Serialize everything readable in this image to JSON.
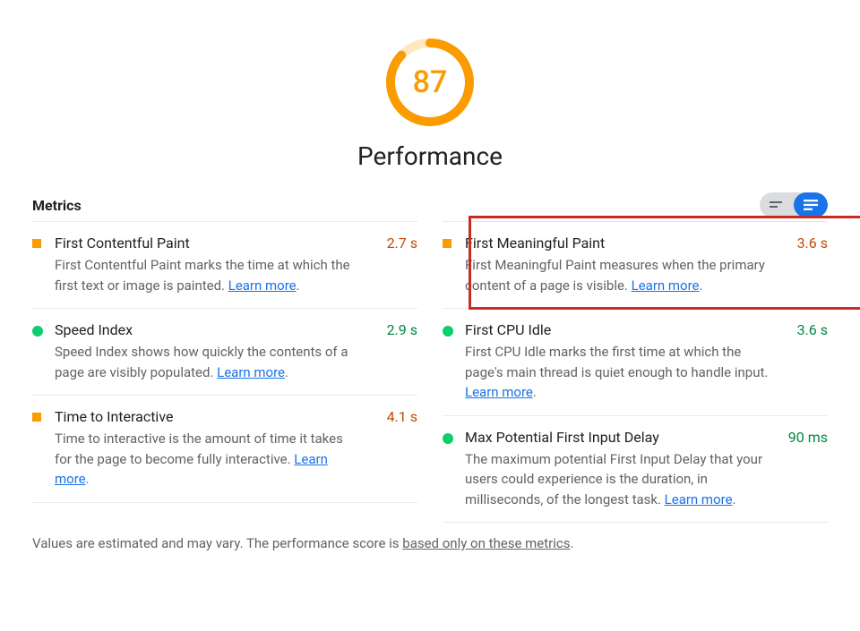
{
  "header": {
    "score": "87",
    "title": "Performance",
    "gauge_color": "#fa9b00",
    "gauge_fraction": 0.87
  },
  "section": {
    "title": "Metrics"
  },
  "learn_more_label": "Learn more",
  "left_metrics": [
    {
      "status": "warn",
      "title": "First Contentful Paint",
      "desc_before": "First Contentful Paint marks the time at which the first text or image is painted. ",
      "desc_after": ".",
      "value": "2.7 s",
      "value_class": "val-warn"
    },
    {
      "status": "pass",
      "title": "Speed Index",
      "desc_before": "Speed Index shows how quickly the contents of a page are visibly populated. ",
      "desc_after": ".",
      "value": "2.9 s",
      "value_class": "val-pass"
    },
    {
      "status": "warn",
      "title": "Time to Interactive",
      "desc_before": "Time to interactive is the amount of time it takes for the page to become fully interactive. ",
      "desc_after": ".",
      "value": "4.1 s",
      "value_class": "val-warn"
    }
  ],
  "right_metrics": [
    {
      "status": "warn",
      "title": "First Meaningful Paint",
      "desc_before": "First Meaningful Paint measures when the primary content of a page is visible. ",
      "desc_after": ".",
      "value": "3.6 s",
      "value_class": "val-warn"
    },
    {
      "status": "pass",
      "title": "First CPU Idle",
      "desc_before": "First CPU Idle marks the first time at which the page's main thread is quiet enough to handle input. ",
      "desc_after": ".",
      "value": "3.6 s",
      "value_class": "val-pass"
    },
    {
      "status": "pass",
      "title": "Max Potential First Input Delay",
      "desc_before": "The maximum potential First Input Delay that your users could experience is the duration, in milliseconds, of the longest task. ",
      "desc_after": ".",
      "value": "90 ms",
      "value_class": "val-pass"
    }
  ],
  "footnote": {
    "prefix": "Values are estimated and may vary. The performance score is ",
    "link": "based only on these metrics",
    "suffix": "."
  }
}
